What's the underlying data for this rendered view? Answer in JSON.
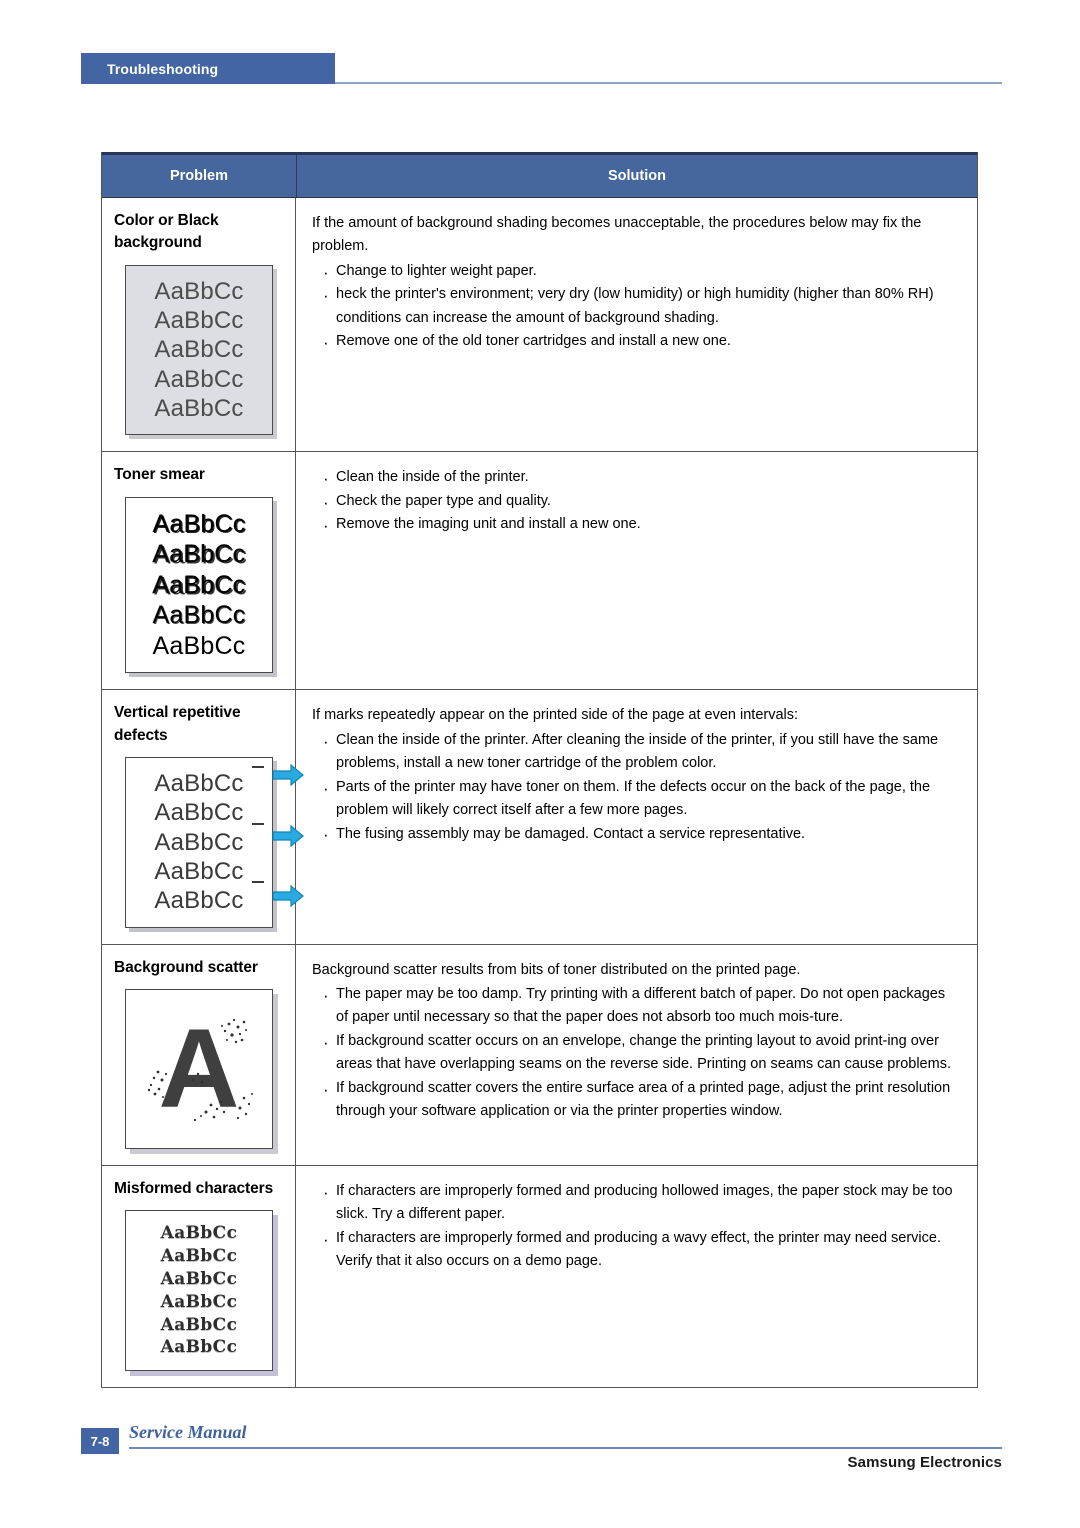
{
  "header": {
    "section_label": "Troubleshooting"
  },
  "table": {
    "columns": {
      "problem": "Problem",
      "solution": "Solution"
    },
    "accent_header_color": "#46669E",
    "accent_tab_color": "#4465A4",
    "rows": [
      {
        "problem_title": "Color or Black background",
        "sample": {
          "kind": "gray-background-page",
          "lines": [
            "AaBbCc",
            "AaBbCc",
            "AaBbCc",
            "AaBbCc",
            "AaBbCc"
          ]
        },
        "lead": "If the amount of background shading becomes unacceptable, the procedures below may fix the problem.",
        "bullets": [
          "Change to lighter weight paper.",
          "heck the printer's environment; very dry (low humidity) or high humidity (higher than 80% RH) conditions can increase the amount of background shading.",
          "Remove one of the old toner cartridges and install a new one."
        ]
      },
      {
        "problem_title": "Toner smear",
        "sample": {
          "kind": "toner-smear-page",
          "lines": [
            "AaBbCc",
            "AaBbCc",
            "AaBbCc",
            "AaBbCc",
            "AaBbCc"
          ]
        },
        "lead": "",
        "bullets": [
          "Clean the inside of the printer.",
          "Check the paper type and quality.",
          "Remove the imaging unit and install a new one."
        ]
      },
      {
        "problem_title": "Vertical repetitive defects",
        "sample": {
          "kind": "vertical-repetitive-defects-page",
          "lines": [
            "AaBbCc",
            "AaBbCc",
            "AaBbCc",
            "AaBbCc",
            "AaBbCc"
          ],
          "arrow_color": "#29ABE2"
        },
        "lead": "If marks repeatedly appear on the printed side of the page at even intervals:",
        "bullets": [
          "Clean the inside of the printer.  After cleaning the inside of the printer, if you still have the same problems, install a new toner cartridge of the problem color.",
          "Parts of the printer may have toner on them. If the defects occur on the back of the page, the problem will likely correct itself after a few more pages.",
          "The fusing assembly may be damaged. Contact a service representative."
        ]
      },
      {
        "problem_title": "Background scatter",
        "sample": {
          "kind": "background-scatter-page",
          "glyph": "A"
        },
        "lead": "Background scatter results from bits of toner distributed on the printed page.",
        "bullets": [
          "The paper may be too damp. Try printing with a different batch of paper. Do not open packages of paper until necessary so that the paper does not absorb too much mois-ture.",
          "If background scatter occurs on an envelope, change the printing layout to avoid print-ing over areas that have overlapping seams on the reverse side. Printing on seams can cause problems.",
          "If background scatter covers the entire surface area of a printed page, adjust the print resolution through your software application or via the printer properties window."
        ]
      },
      {
        "problem_title": "Misformed characters",
        "sample": {
          "kind": "misformed-characters-page",
          "lines": [
            "AaBbCc",
            "AaBbCc",
            "AaBbCc",
            "AaBbCc",
            "AaBbCc",
            "AaBbCc"
          ]
        },
        "lead": "",
        "bullets": [
          "If characters are improperly formed and producing hollowed images, the paper stock may be too slick. Try a different paper.",
          "If characters are improperly formed and producing a wavy effect, the printer may need service. Verify that it also occurs on a demo page."
        ]
      }
    ]
  },
  "footer": {
    "page_number": "7-8",
    "manual_title": "Service Manual",
    "company": "Samsung Electronics"
  }
}
